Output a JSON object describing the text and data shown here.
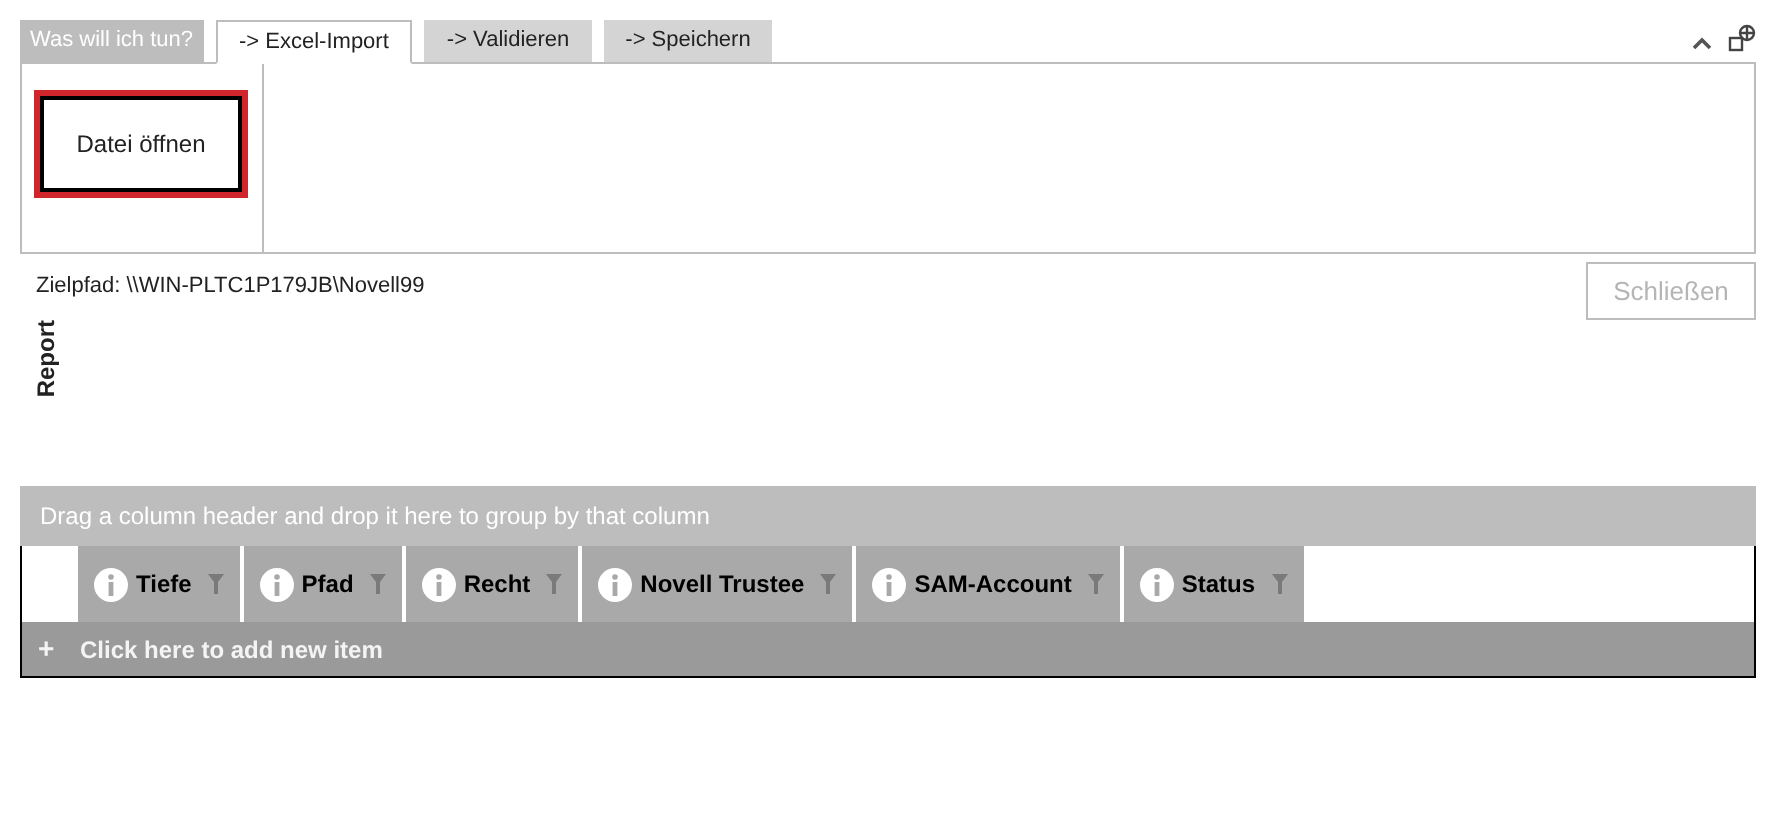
{
  "ribbon": {
    "caption": "Was will ich tun?",
    "tabs": [
      {
        "label": "-> Excel-Import",
        "selected": true
      },
      {
        "label": "-> Validieren",
        "selected": false
      },
      {
        "label": "-> Speichern",
        "selected": false
      }
    ],
    "open_button": {
      "label": "Datei öffnen",
      "focused": true
    }
  },
  "target_path": "Zielpfad: \\\\WIN-PLTC1P179JB\\Novell99",
  "close_button": {
    "label": "Schließen",
    "disabled": true
  },
  "report_label": "Report",
  "grid": {
    "group_panel": "Drag a column header and drop it here to group by that column",
    "columns": [
      "Tiefe",
      "Pfad",
      "Recht",
      "Novell Trustee",
      "SAM-Account",
      "Status"
    ],
    "add_row": {
      "icon": "+",
      "text": "Click here to add new item"
    }
  }
}
